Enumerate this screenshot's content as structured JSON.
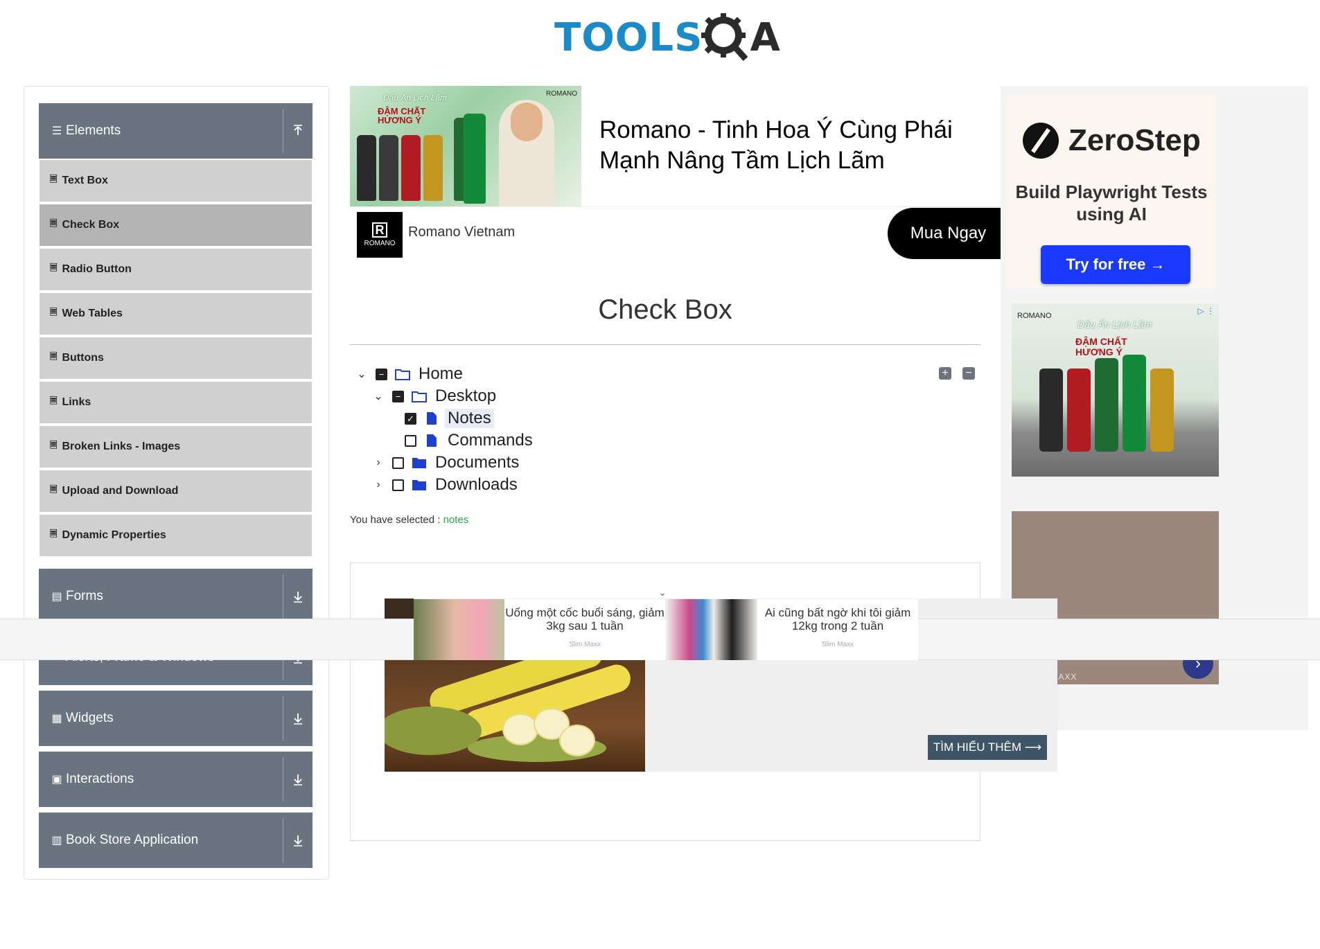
{
  "header": {
    "logo_tools": "TOOLS",
    "logo_qa": "QA"
  },
  "sidebar": {
    "groups": [
      {
        "label": "Elements",
        "icon": "hamburger-icon",
        "state": "expanded"
      },
      {
        "label": "Forms",
        "icon": "form-icon",
        "state": "collapsed"
      },
      {
        "label": "Alerts, Frame & Windows",
        "icon": "window-icon",
        "state": "collapsed"
      },
      {
        "label": "Widgets",
        "icon": "grid-icon",
        "state": "collapsed"
      },
      {
        "label": "Interactions",
        "icon": "interaction-icon",
        "state": "collapsed"
      },
      {
        "label": "Book Store Application",
        "icon": "book-icon",
        "state": "collapsed"
      }
    ],
    "elements_items": [
      {
        "label": "Text Box"
      },
      {
        "label": "Check Box",
        "active": true
      },
      {
        "label": "Radio Button"
      },
      {
        "label": "Web Tables"
      },
      {
        "label": "Buttons"
      },
      {
        "label": "Links"
      },
      {
        "label": "Broken Links - Images"
      },
      {
        "label": "Upload and Download"
      },
      {
        "label": "Dynamic Properties"
      }
    ]
  },
  "top_ad": {
    "title": "Romano - Tinh Hoa Ý Cùng Phái Mạnh Nâng Tầm Lịch Lãm",
    "advertiser": "Romano Vietnam",
    "logo_text": "ROMANO",
    "logo_letter": "R",
    "cta": "Mua Ngay",
    "img_script": "Dấu Ấn Lịch Lãm",
    "img_slogan": "ĐẬM CHẤT HƯƠNG Ý",
    "img_brand": "ROMANO"
  },
  "main": {
    "title": "Check Box",
    "tree": [
      {
        "label": "Home",
        "state": "partial",
        "expanded": true,
        "type": "folder-open"
      },
      {
        "label": "Desktop",
        "state": "partial",
        "expanded": true,
        "type": "folder-open"
      },
      {
        "label": "Notes",
        "state": "checked",
        "type": "file"
      },
      {
        "label": "Commands",
        "state": "unchecked",
        "type": "file"
      },
      {
        "label": "Documents",
        "state": "unchecked",
        "expanded": false,
        "type": "folder"
      },
      {
        "label": "Downloads",
        "state": "unchecked",
        "expanded": false,
        "type": "folder"
      }
    ],
    "result_label": "You have selected :",
    "result_value": "notes",
    "expand_all_icon": "plus-square-icon",
    "collapse_all_icon": "minus-square-icon"
  },
  "banana_ad": {
    "cta": "TÌM HIỂU THÊM ⟶"
  },
  "sticky_ad": {
    "cards": [
      {
        "text": "Uống một cốc buổi sáng, giảm 3kg sau 1 tuần",
        "source": "Slim Maxx"
      },
      {
        "text": "Ai cũng bất ngờ khi tôi giảm 12kg trong 2 tuần",
        "source": "Slim Maxx"
      }
    ]
  },
  "right_ads": {
    "zerostep_name": "ZeroStep",
    "zerostep_tagline": "Build Playwright Tests using AI",
    "zerostep_cta": "Try for free →",
    "romano_logo": "ROMANO",
    "romano_script": "Dấu Ấn Lịch Lãm",
    "romano_slogan": "ĐẬM CHẤT HƯƠNG Ý",
    "slim_label": "SLIM MAXX"
  },
  "colors": {
    "sidebar_header": "#6a7480",
    "menu_item": "#d0d0d0",
    "menu_active": "#b4b4b4",
    "result_value": "#28a745",
    "cta_blue": "#1a3bff",
    "banana_cta": "#3e5467"
  }
}
